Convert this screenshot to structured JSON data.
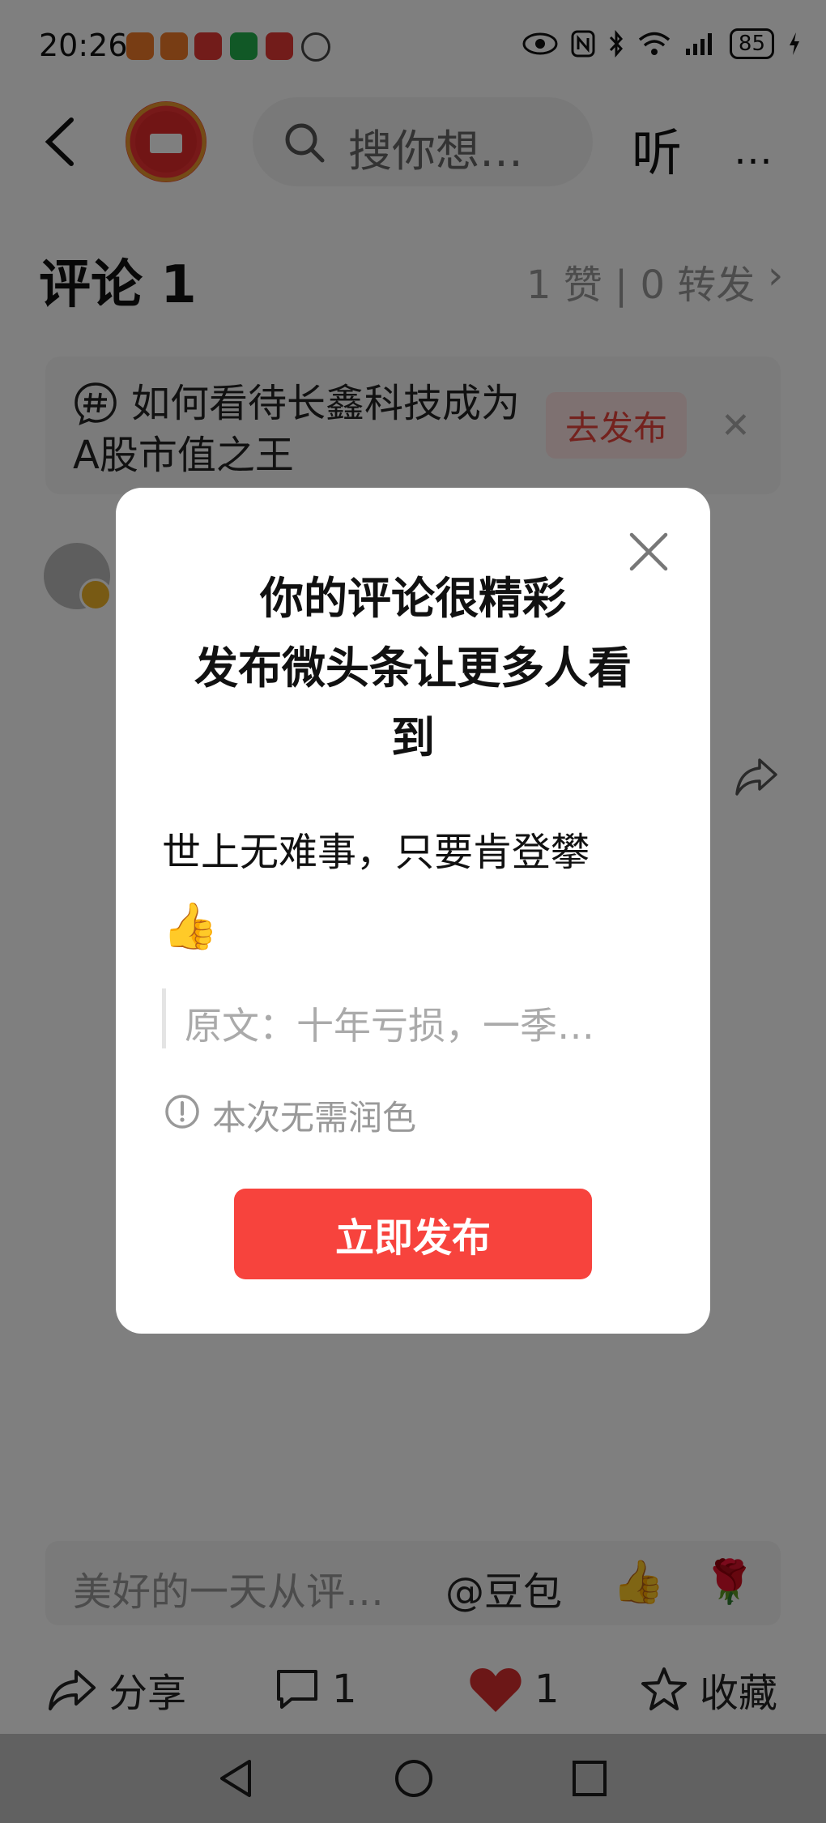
{
  "status_bar": {
    "time": "20:26",
    "battery": "85"
  },
  "header": {
    "search_placeholder": "搜你想…",
    "listen_label": "听",
    "more_label": "⋯"
  },
  "comments": {
    "title": "评论 1",
    "stats": "1 赞 | 0 转发",
    "chevron": "›"
  },
  "topic": {
    "text": "如何看待长鑫科技成为A股市值之王",
    "publish_label": "去发布",
    "close_label": "✕"
  },
  "bottom": {
    "input_placeholder": "美好的一天从评…",
    "doubao_label": "@豆包",
    "emoji_thumb": "👍",
    "emoji_rose": "🌹",
    "share_label": "分享",
    "comment_count": "1",
    "like_count": "1",
    "favorite_label": "收藏"
  },
  "modal": {
    "title_line1": "你的评论很精彩",
    "title_line2": "发布微头条让更多人看",
    "title_line3": "到",
    "comment_text": "世上无难事，只要肯登攀",
    "comment_emoji": "👍",
    "quote_text": "原文：十年亏损，一季…",
    "notice_text": "本次无需润色",
    "publish_button": "立即发布"
  },
  "colors": {
    "accent_red": "#f7433d",
    "topic_publish_bg": "#fde3e3",
    "like_red": "#d92f2f"
  }
}
